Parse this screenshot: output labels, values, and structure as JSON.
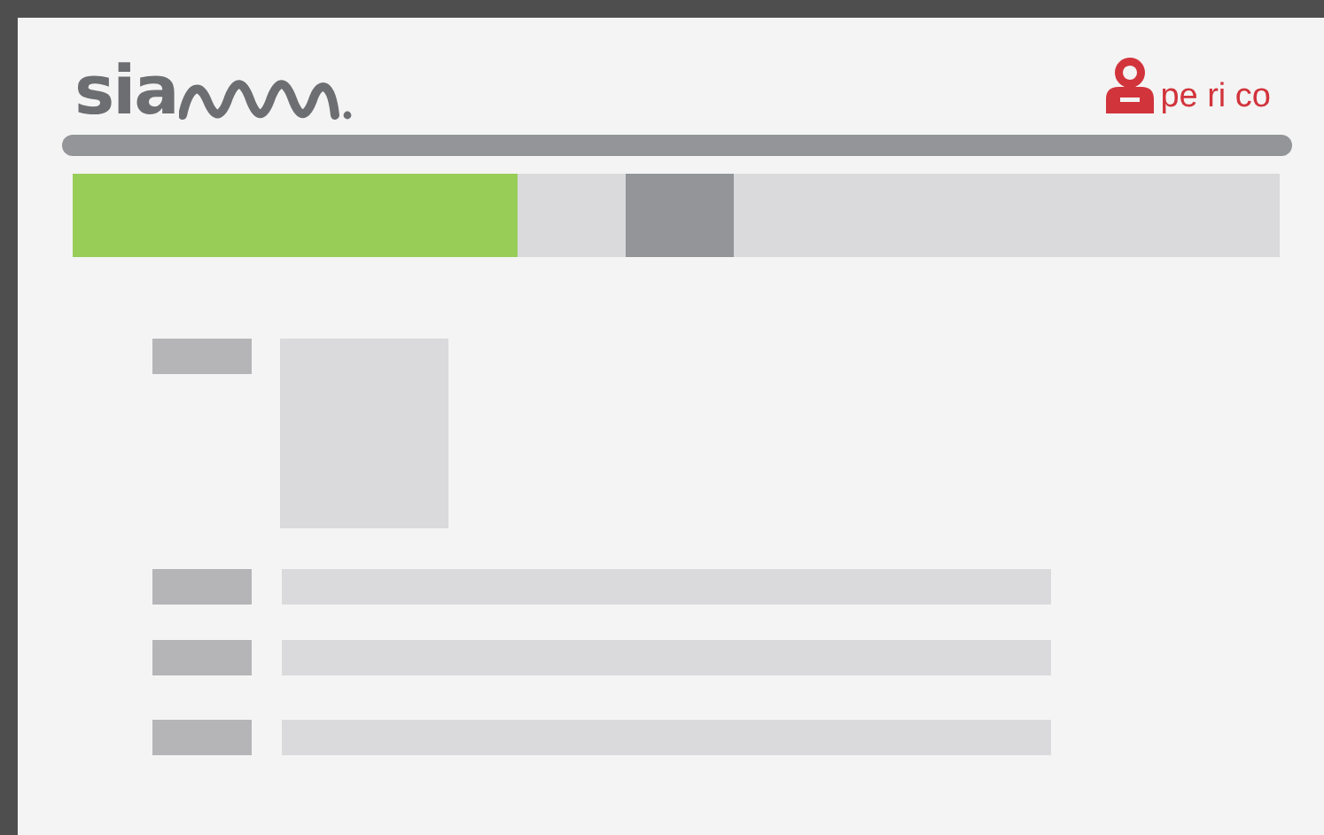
{
  "header": {
    "logo_text": "sia",
    "user_name": "pe ri co"
  },
  "nav_bar": {
    "segments": [
      {
        "kind": "active"
      },
      {
        "kind": "blank"
      },
      {
        "kind": "marker"
      },
      {
        "kind": "blank"
      }
    ]
  },
  "form": {
    "rows": [
      {
        "kind": "image"
      },
      {
        "kind": "line"
      },
      {
        "kind": "line"
      },
      {
        "kind": "line"
      }
    ]
  }
}
